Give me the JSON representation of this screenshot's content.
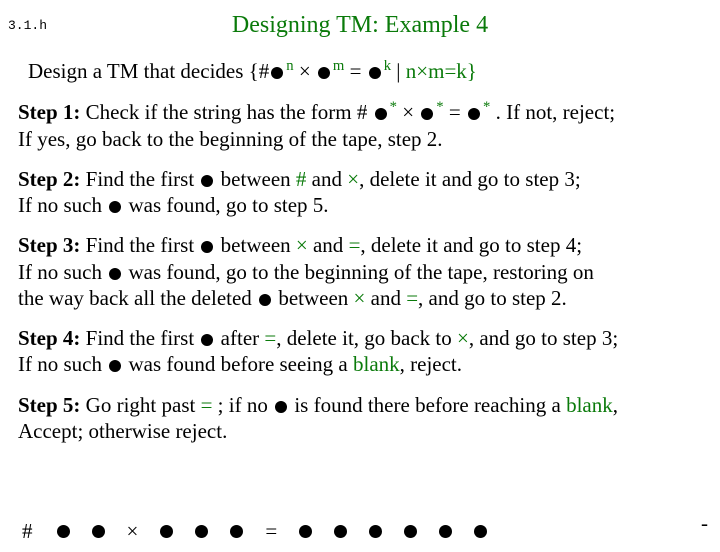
{
  "slide_number": "3.1.h",
  "title": "Designing TM: Example 4",
  "design": {
    "prefix": "Design a TM that decides  {#",
    "exp_n": "n",
    "times1": " × ",
    "exp_m": "m",
    "eq": " = ",
    "exp_k": "k",
    "bar": " | ",
    "cond": " n×m=k}",
    "n_label": "n",
    "m_label": "m",
    "k_label": "k"
  },
  "step1": {
    "label": "Step 1:",
    "t1": " Check if the string has the form  # ",
    "star1": "*",
    "times": " × ",
    "star2": "*",
    "eq": " = ",
    "star3": "*",
    "t2": " . If not, reject;",
    "l2": "If yes, go back to the beginning of the tape, step 2."
  },
  "step2": {
    "label": "Step 2:",
    "t1": " Find the first ",
    "t2": " between ",
    "hash": "#",
    "t3": " and ",
    "times": "×",
    "t4": ", delete it and go to step 3;",
    "l2a": "If no such ",
    "l2b": "  was found, go to step 5."
  },
  "step3": {
    "label": "Step 3:",
    "t1": " Find the first ",
    "t2": " between ",
    "times1": "×",
    "t3": " and ",
    "eq": "=",
    "t4": ", delete it and go to step 4;",
    "l2a": "If no such ",
    "l2b": "  was found, go to the beginning of the tape, restoring on",
    "l3a": "the way back all the deleted ",
    "l3b": " between ",
    "times2": "×",
    "l3c": " and ",
    "eq2": "=",
    "l3d": ",  and go to step 2."
  },
  "step4": {
    "label": "Step 4:",
    "t1": " Find the first ",
    "t2": " after  ",
    "eq": "=",
    "t3": ", delete it,  go back to ",
    "times": "×",
    "t4": ", and go to step 3;",
    "l2a": "If no such ",
    "l2b": "  was found before seeing a ",
    "blank": "blank",
    "l2c": ", reject."
  },
  "step5": {
    "label": "Step 5:",
    "t1": " Go right past ",
    "eq": "=",
    "t2": " ; if no ",
    "t3": " is found there before reaching a ",
    "blank": "blank",
    "t4": ",",
    "l2": "Accept; otherwise reject."
  },
  "tape": {
    "hash": "#",
    "times": "×",
    "eq": "=",
    "dash": "-"
  }
}
